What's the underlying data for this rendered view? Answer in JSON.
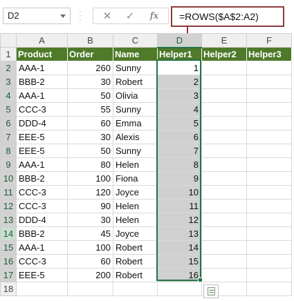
{
  "name_box": {
    "value": "D2"
  },
  "formula_bar": {
    "cancel_symbol": "✕",
    "enter_symbol": "✓",
    "fx_symbol": "fx",
    "formula": "=ROWS($A$2:A2)"
  },
  "columns": [
    "A",
    "B",
    "C",
    "D",
    "E",
    "F"
  ],
  "selected_column": "D",
  "rows": [
    "1",
    "2",
    "3",
    "4",
    "5",
    "6",
    "7",
    "8",
    "9",
    "10",
    "11",
    "12",
    "13",
    "14",
    "15",
    "16",
    "17",
    "18"
  ],
  "headers": [
    "Product",
    "Order",
    "Name",
    "Helper1",
    "Helper2",
    "Helper3"
  ],
  "data": [
    {
      "product": "AAA-1",
      "order": "260",
      "name": "Sunny",
      "helper1": "1"
    },
    {
      "product": "BBB-2",
      "order": "30",
      "name": "Robert",
      "helper1": "2"
    },
    {
      "product": "AAA-1",
      "order": "50",
      "name": "Olivia",
      "helper1": "3"
    },
    {
      "product": "CCC-3",
      "order": "55",
      "name": "Sunny",
      "helper1": "4"
    },
    {
      "product": "DDD-4",
      "order": "60",
      "name": "Emma",
      "helper1": "5"
    },
    {
      "product": "EEE-5",
      "order": "30",
      "name": "Alexis",
      "helper1": "6"
    },
    {
      "product": "EEE-5",
      "order": "50",
      "name": "Sunny",
      "helper1": "7"
    },
    {
      "product": "AAA-1",
      "order": "80",
      "name": "Helen",
      "helper1": "8"
    },
    {
      "product": "BBB-2",
      "order": "100",
      "name": "Fiona",
      "helper1": "9"
    },
    {
      "product": "CCC-3",
      "order": "120",
      "name": "Joyce",
      "helper1": "10"
    },
    {
      "product": "CCC-3",
      "order": "90",
      "name": "Helen",
      "helper1": "11"
    },
    {
      "product": "DDD-4",
      "order": "30",
      "name": "Helen",
      "helper1": "12"
    },
    {
      "product": "BBB-2",
      "order": "45",
      "name": "Joyce",
      "helper1": "13"
    },
    {
      "product": "AAA-1",
      "order": "100",
      "name": "Robert",
      "helper1": "14"
    },
    {
      "product": "CCC-3",
      "order": "60",
      "name": "Robert",
      "helper1": "15"
    },
    {
      "product": "EEE-5",
      "order": "200",
      "name": "Robert",
      "helper1": "16"
    }
  ],
  "colors": {
    "header_fill": "#4e7a2a",
    "selection_border": "#217346",
    "selection_fill": "#d0d0d0",
    "callout_border": "#8a3a3a"
  },
  "icons": {
    "quick_analysis": "quick-analysis-icon",
    "namebox_dropdown": "chevron-down-icon"
  }
}
